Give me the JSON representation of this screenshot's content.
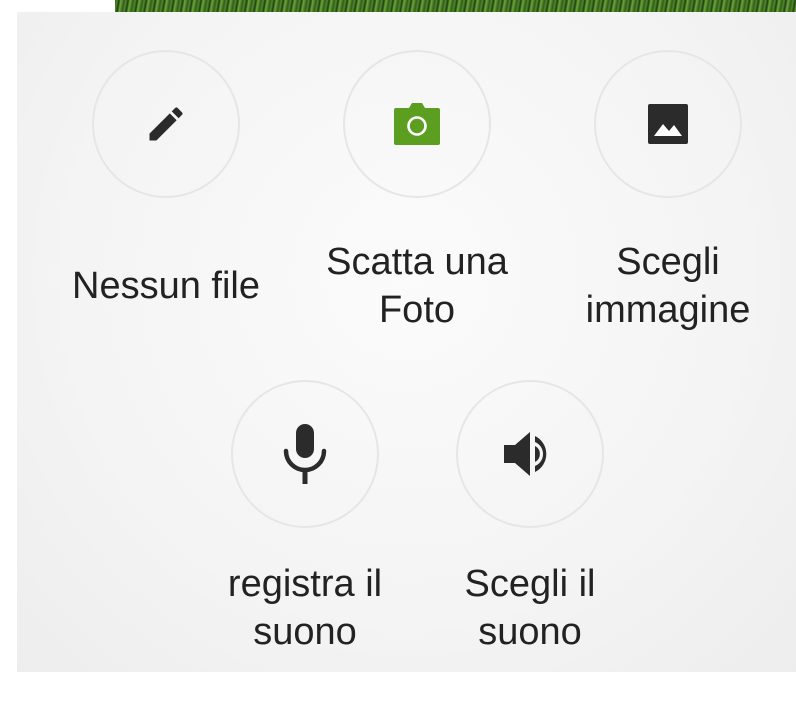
{
  "options": [
    {
      "id": "no-file",
      "label": "Nessun file",
      "icon": "pencil-icon"
    },
    {
      "id": "take-photo",
      "label_line1": "Scatta una",
      "label_line2": "Foto",
      "icon": "camera-icon",
      "icon_color": "#5c9e1f"
    },
    {
      "id": "choose-image",
      "label_line1": "Scegli",
      "label_line2": "immagine",
      "icon": "image-icon"
    },
    {
      "id": "record-sound",
      "label_line1": "registra il",
      "label_line2": "suono",
      "icon": "microphone-icon"
    },
    {
      "id": "choose-sound",
      "label_line1": "Scegli il",
      "label_line2": "suono",
      "icon": "speaker-icon"
    }
  ],
  "colors": {
    "icon_dark": "#2b2b2b",
    "accent_green": "#5c9e1f",
    "circle_border": "#e6e6e6",
    "sheet_background": "#f4f4f4"
  }
}
